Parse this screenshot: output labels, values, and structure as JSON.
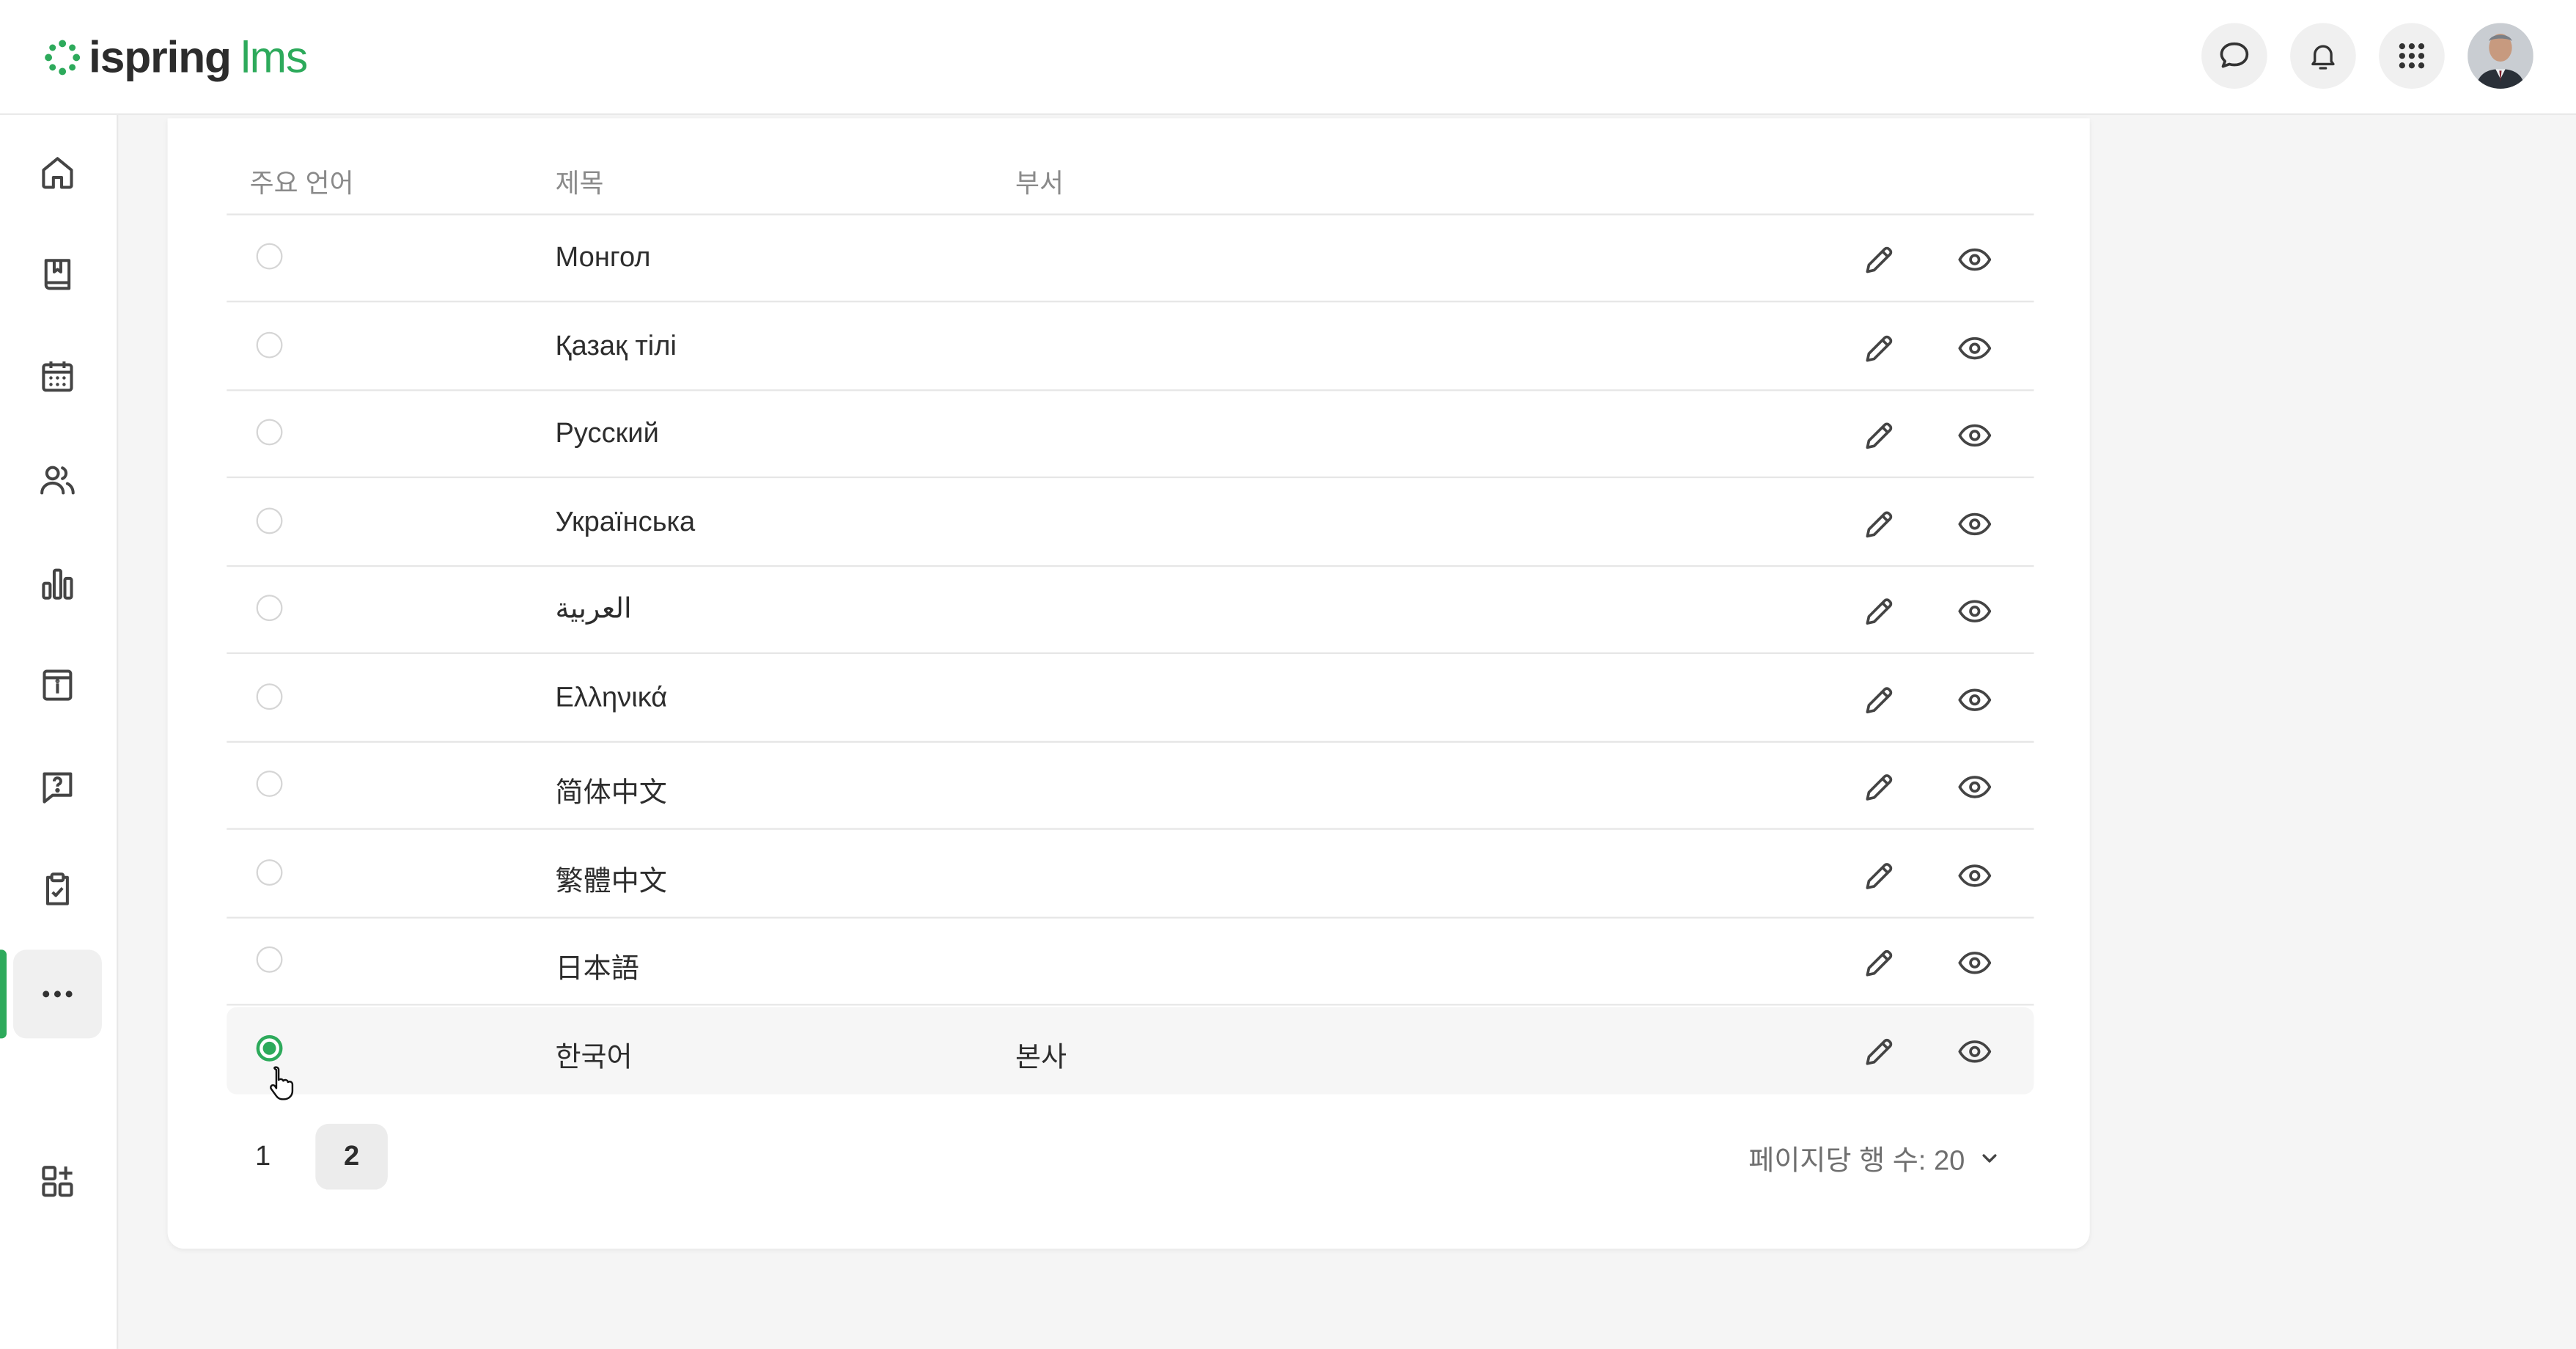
{
  "brand": {
    "name": "ispring",
    "suffix": "lms",
    "accent_color": "#2daa5b"
  },
  "topbar": {
    "icons": [
      "chat-icon",
      "bell-icon",
      "apps-grid-icon",
      "user-avatar"
    ]
  },
  "sidebar": {
    "items": [
      {
        "icon": "home-icon"
      },
      {
        "icon": "book-icon"
      },
      {
        "icon": "calendar-icon"
      },
      {
        "icon": "users-icon"
      },
      {
        "icon": "reports-bar-chart-icon"
      },
      {
        "icon": "info-archive-icon"
      },
      {
        "icon": "help-question-icon"
      },
      {
        "icon": "clipboard-check-icon"
      },
      {
        "icon": "more-dots-icon",
        "active": true
      },
      {
        "icon": "add-widgets-icon"
      }
    ]
  },
  "table": {
    "headers": {
      "primary_language": "주요 언어",
      "title": "제목",
      "department": "부서"
    },
    "rows": [
      {
        "title": "Монгол",
        "department": "",
        "selected": false
      },
      {
        "title": "Қазақ тілі",
        "department": "",
        "selected": false
      },
      {
        "title": "Русский",
        "department": "",
        "selected": false
      },
      {
        "title": "Українська",
        "department": "",
        "selected": false
      },
      {
        "title": "العربية",
        "department": "",
        "selected": false
      },
      {
        "title": "Ελληνικά",
        "department": "",
        "selected": false
      },
      {
        "title": "简体中文",
        "department": "",
        "selected": false
      },
      {
        "title": "繁體中文",
        "department": "",
        "selected": false
      },
      {
        "title": "日本語",
        "department": "",
        "selected": false
      },
      {
        "title": "한국어",
        "department": "본사",
        "selected": true
      }
    ]
  },
  "pagination": {
    "pages": [
      "1",
      "2"
    ],
    "current": "2",
    "rows_per_page_label": "페이지당 행 수: 20"
  }
}
